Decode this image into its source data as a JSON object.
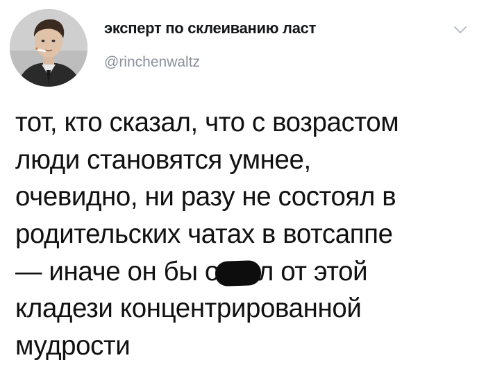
{
  "author": {
    "display_name": "эксперт по склеиванию ласт",
    "handle": "@rinchenwaltz",
    "avatar_icon": "profile-photo",
    "menu_icon": "chevron-down-icon"
  },
  "tweet": {
    "lines": [
      "тот, кто сказал, что с возрастом",
      "люди становятся умнее,",
      "очевидно, ни разу не состоял в",
      "родительских чатах в вотсаппе",
      "— иначе он бы о",
      "кладези концентрированной",
      "мудрости"
    ],
    "redacted_line_tail": "л от этой"
  },
  "colors": {
    "name": "#14171a",
    "handle": "#8a9099",
    "text": "#111111",
    "chevron": "#b8bec5"
  }
}
